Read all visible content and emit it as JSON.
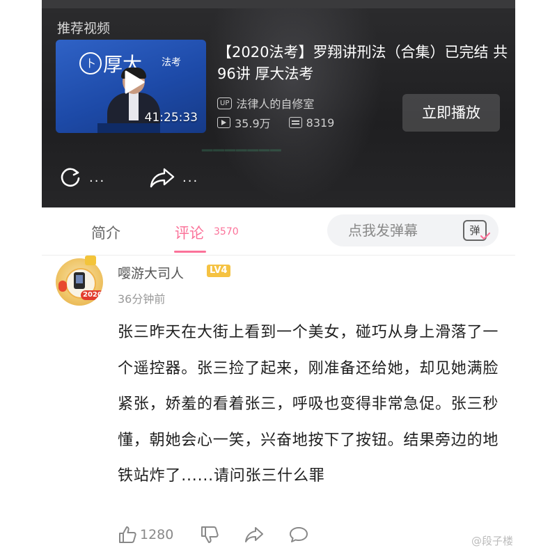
{
  "player": {
    "section_label": "推荐视频",
    "thumbnail": {
      "logo_text": "厚大",
      "logo_sub": "法考",
      "duration": "41:25:33"
    },
    "title": "【2020法考】罗翔讲刑法（合集）已完结 共96讲 厚大法考",
    "uploader_badge": "UP",
    "uploader": "法律人的自修室",
    "views": "35.9万",
    "danmaku_count": "8319",
    "play_button": "立即播放",
    "replay_more": "...",
    "share_more": "..."
  },
  "tabs": {
    "intro": "简介",
    "comments": "评论",
    "comments_count": "3570",
    "danmaku_placeholder": "点我发弹幕",
    "danmaku_icon_char": "弹"
  },
  "comment": {
    "avatar_badge": "2020",
    "username": "嘤游大司人",
    "level": "LV4",
    "time": "36分钟前",
    "text": "张三昨天在大街上看到一个美女，碰巧从身上滑落了一个遥控器。张三捡了起来，刚准备还给她，却见她满脸紧张，娇羞的看着张三，呼吸也变得非常急促。张三秒懂，朝她会心一笑，兴奋地按下了按钮。结果旁边的地铁站炸了......请问张三什么罪",
    "likes": "1280"
  },
  "watermark": "@段子楼",
  "colors": {
    "accent": "#fb7299",
    "level_badge": "#f5c242",
    "thumbnail_blue": "#1d4aa8"
  }
}
